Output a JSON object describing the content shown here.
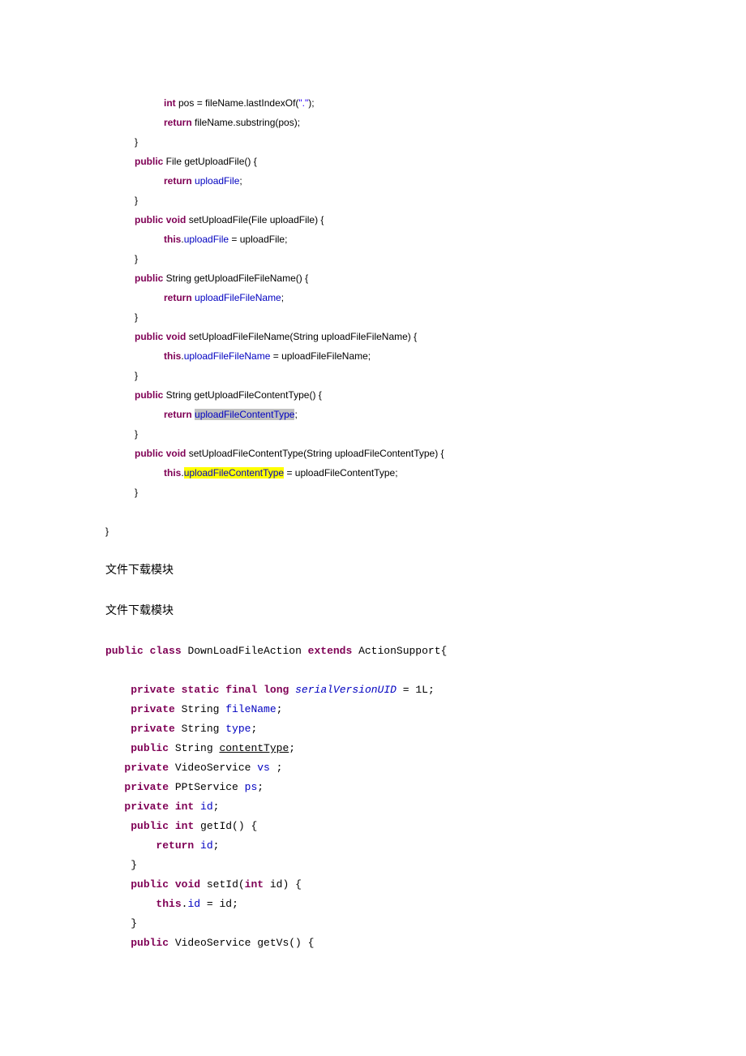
{
  "block1": {
    "l1_kw": "int",
    "l1_rest": " pos = fileName.lastIndexOf(",
    "l1_str": "\".\"",
    "l1_end": ");",
    "l2_kw": "return",
    "l2_rest": " fileName.substring(pos);",
    "l3": "}",
    "l4_kw": "public",
    "l4_rest": " File getUploadFile() {",
    "l5_kw": "return",
    "l5_sp": " ",
    "l5_fld": "uploadFile",
    "l5_end": ";",
    "l6": "}",
    "l7_kw1": "public",
    "l7_sp1": " ",
    "l7_kw2": "void",
    "l7_rest": " setUploadFile(File uploadFile) {",
    "l8_kw": "this",
    "l8_dot": ".",
    "l8_fld": "uploadFile",
    "l8_rest": " = uploadFile;",
    "l9": "}",
    "l10_kw": "public",
    "l10_rest": " String getUploadFileFileName() {",
    "l11_kw": "return",
    "l11_sp": " ",
    "l11_fld": "uploadFileFileName",
    "l11_end": ";",
    "l12": "}",
    "l13_kw1": "public",
    "l13_sp1": " ",
    "l13_kw2": "void",
    "l13_rest": " setUploadFileFileName(String uploadFileFileName) {",
    "l14_kw": "this",
    "l14_dot": ".",
    "l14_fld": "uploadFileFileName",
    "l14_rest": " = uploadFileFileName;",
    "l15": "}",
    "l16_kw": "public",
    "l16_rest": " String getUploadFileContentType() {",
    "l17_kw": "return",
    "l17_sp": " ",
    "l17_fld": "uploadFileContentType",
    "l17_end": ";",
    "l18": "}",
    "l19_kw1": "public",
    "l19_sp1": " ",
    "l19_kw2": "void",
    "l19_rest": " setUploadFileContentType(String uploadFileContentType) {",
    "l20_kw": "this",
    "l20_dot": ".",
    "l20_fld": "uploadFileContentType",
    "l20_rest": " = uploadFileContentType;",
    "l21": "}",
    "l22": "}"
  },
  "section1": "文件下载模块",
  "section2": "文件下载模块",
  "block2": {
    "l1_kw1": "public",
    "l1_sp1": " ",
    "l1_kw2": "class",
    "l1_mid": " DownLoadFileAction ",
    "l1_kw3": "extends",
    "l1_end": " ActionSupport{",
    "l2_kw1": "private",
    "l2_sp1": " ",
    "l2_kw2": "static",
    "l2_sp2": " ",
    "l2_kw3": "final",
    "l2_sp3": " ",
    "l2_kw4": "long",
    "l2_sp4": " ",
    "l2_fld": "serialVersionUID",
    "l2_end": " = 1L;",
    "l3_kw": "private",
    "l3_mid": " String ",
    "l3_fld": "fileName",
    "l3_end": ";",
    "l4_kw": "private",
    "l4_mid": " String ",
    "l4_fld": "type",
    "l4_end": ";",
    "l5_kw": "public",
    "l5_mid": " String ",
    "l5_fld": "contentType",
    "l5_end": ";",
    "l6_kw": "private",
    "l6_mid": " VideoService ",
    "l6_fld": "vs",
    "l6_end": " ;",
    "l7_kw": "private",
    "l7_mid": " PPtService ",
    "l7_fld": "ps",
    "l7_end": ";",
    "l8_kw1": "private",
    "l8_sp1": " ",
    "l8_kw2": "int",
    "l8_sp2": " ",
    "l8_fld": "id",
    "l8_end": ";",
    "l9_kw1": "public",
    "l9_sp1": " ",
    "l9_kw2": "int",
    "l9_end": " getId() {",
    "l10_kw": "return",
    "l10_sp": " ",
    "l10_fld": "id",
    "l10_end": ";",
    "l11": "}",
    "l12_kw1": "public",
    "l12_sp1": " ",
    "l12_kw2": "void",
    "l12_mid": " setId(",
    "l12_kw3": "int",
    "l12_end": " id) {",
    "l13_kw": "this",
    "l13_dot": ".",
    "l13_fld": "id",
    "l13_end": " = id;",
    "l14": "}",
    "l15_kw": "public",
    "l15_end": " VideoService getVs() {"
  }
}
